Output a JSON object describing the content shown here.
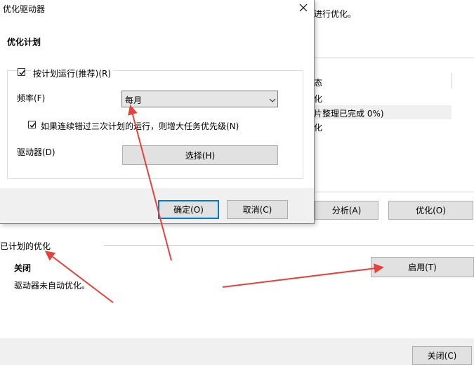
{
  "background": {
    "top_text": "进行优化。",
    "status_items": [
      "态",
      "化",
      "片整理已完成 0%)",
      "化"
    ],
    "analyze_button": "分析(A)",
    "optimize_button": "优化(O)",
    "scheduled_section_title": "已计划的优化",
    "schedule_state": "关闭",
    "schedule_desc": "驱动器未自动优化。",
    "enable_button": "启用(T)",
    "close_button": "关闭(C)"
  },
  "dialog": {
    "title": "优化驱动器",
    "section_title": "优化计划",
    "run_on_schedule_label": "按计划运行(推荐)(R)",
    "frequency_label": "频率(F)",
    "frequency_value": "每月",
    "increase_priority_label": "如果连续错过三次计划的运行，则增大任务优先级(N)",
    "drives_label": "驱动器(D)",
    "choose_button": "选择(H)",
    "ok_button": "确定(O)",
    "cancel_button": "取消(C)"
  },
  "colors": {
    "accent": "#0078d7",
    "annotation_arrow": "#e8403a",
    "button_bg": "#e1e1e1",
    "selected_row": "#f0f0f0"
  }
}
